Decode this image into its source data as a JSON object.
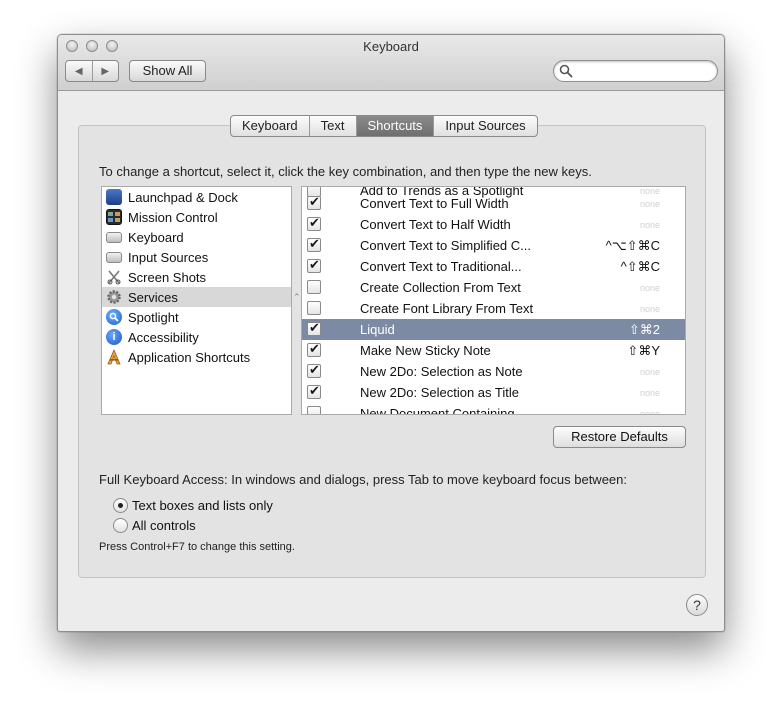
{
  "window": {
    "title": "Keyboard",
    "back_glyph": "◀",
    "forward_glyph": "▶",
    "show_all_label": "Show All",
    "search_placeholder": ""
  },
  "tabs": [
    {
      "label": "Keyboard",
      "active": false
    },
    {
      "label": "Text",
      "active": false
    },
    {
      "label": "Shortcuts",
      "active": true
    },
    {
      "label": "Input Sources",
      "active": false
    }
  ],
  "instructions": "To change a shortcut, select it, click the key combination, and then type the new keys.",
  "categories": [
    {
      "label": "Launchpad & Dock",
      "icon": "launchpad-dock-icon",
      "selected": false
    },
    {
      "label": "Mission Control",
      "icon": "mission-control-icon",
      "selected": false
    },
    {
      "label": "Keyboard",
      "icon": "keyboard-icon",
      "selected": false
    },
    {
      "label": "Input Sources",
      "icon": "input-sources-icon",
      "selected": false
    },
    {
      "label": "Screen Shots",
      "icon": "screen-shots-icon",
      "selected": false
    },
    {
      "label": "Services",
      "icon": "services-gear-icon",
      "selected": true
    },
    {
      "label": "Spotlight",
      "icon": "spotlight-icon",
      "selected": false
    },
    {
      "label": "Accessibility",
      "icon": "accessibility-icon",
      "selected": false
    },
    {
      "label": "Application Shortcuts",
      "icon": "app-shortcuts-icon",
      "selected": false
    }
  ],
  "splitter_glyph": "⌃",
  "shortcuts": [
    {
      "label": "Add to Trends as a Spotlight",
      "checked": false,
      "key": "none",
      "selected": false
    },
    {
      "label": "Convert Text to Full Width",
      "checked": true,
      "key": "none",
      "selected": false
    },
    {
      "label": "Convert Text to Half Width",
      "checked": true,
      "key": "none",
      "selected": false
    },
    {
      "label": "Convert Text to Simplified C...",
      "checked": true,
      "key": "^⌥⇧⌘C",
      "selected": false
    },
    {
      "label": "Convert Text to Traditional...",
      "checked": true,
      "key": "^⇧⌘C",
      "selected": false
    },
    {
      "label": "Create Collection From Text",
      "checked": false,
      "key": "none",
      "selected": false
    },
    {
      "label": "Create Font Library From Text",
      "checked": false,
      "key": "none",
      "selected": false
    },
    {
      "label": "Liquid",
      "checked": true,
      "key": "⇧⌘2",
      "selected": true
    },
    {
      "label": "Make New Sticky Note",
      "checked": true,
      "key": "⇧⌘Y",
      "selected": false
    },
    {
      "label": "New 2Do: Selection as Note",
      "checked": true,
      "key": "none",
      "selected": false
    },
    {
      "label": "New 2Do: Selection as Title",
      "checked": true,
      "key": "none",
      "selected": false
    },
    {
      "label": "New Document Containing",
      "checked": false,
      "key": "none",
      "selected": false
    }
  ],
  "restore_defaults_label": "Restore Defaults",
  "full_keyboard_access": {
    "text": "Full Keyboard Access: In windows and dialogs, press Tab to move keyboard focus between:",
    "options": [
      {
        "label": "Text boxes and lists only",
        "selected": true
      },
      {
        "label": "All controls",
        "selected": false
      }
    ],
    "note": "Press Control+F7 to change this setting."
  },
  "help_glyph": "?"
}
